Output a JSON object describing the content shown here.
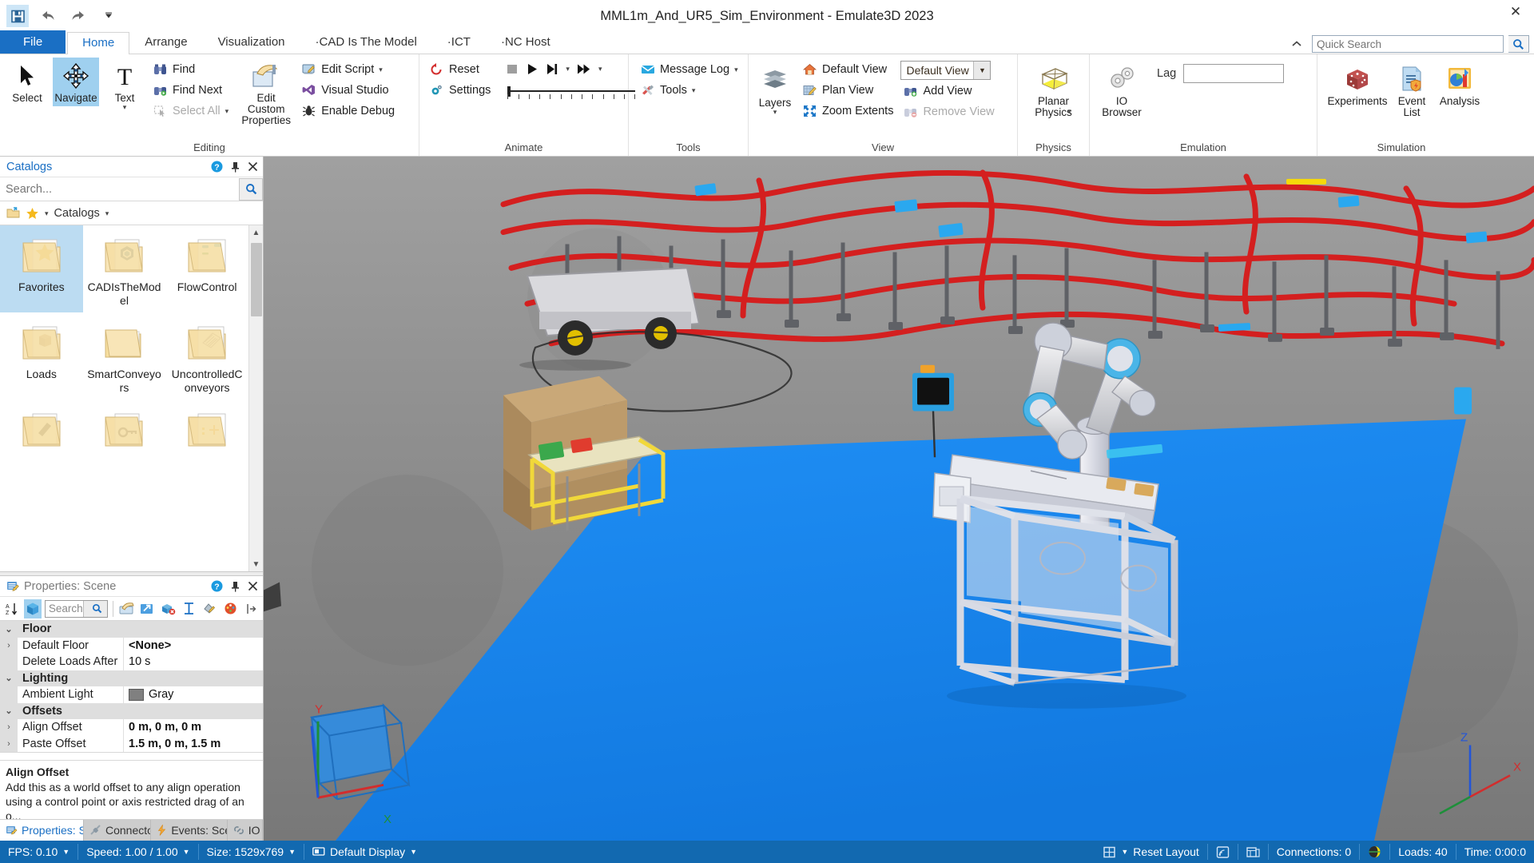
{
  "window": {
    "title": "MML1m_And_UR5_Sim_Environment - Emulate3D 2023",
    "close_label": "✕"
  },
  "quick_access": {
    "save_icon": "save-icon",
    "undo_icon": "undo-icon",
    "redo_icon": "redo-icon",
    "more_icon": "chevron-down-icon"
  },
  "tabs": [
    {
      "label": "File",
      "type": "file"
    },
    {
      "label": "Home",
      "type": "active"
    },
    {
      "label": "Arrange",
      "type": "normal"
    },
    {
      "label": "Visualization",
      "type": "normal"
    },
    {
      "label": "·CAD Is The Model",
      "type": "normal"
    },
    {
      "label": "·ICT",
      "type": "normal"
    },
    {
      "label": "·NC Host",
      "type": "normal"
    }
  ],
  "collapse_ribbon_icon": "chevron-up-icon",
  "search": {
    "placeholder": "Quick Search",
    "value": "",
    "icon": "search-icon"
  },
  "ribbon": {
    "groups": [
      {
        "label": "Editing",
        "big_buttons": [
          {
            "label": "Select",
            "icon": "cursor-arrow-icon",
            "selected": false
          },
          {
            "label": "Navigate",
            "icon": "move-cross-icon",
            "selected": true
          },
          {
            "label": "Text",
            "icon": "text-t-icon",
            "selected": false,
            "dropdown": true
          },
          {
            "label": "Edit Custom\nProperties",
            "icon": "edit-custom-properties-icon",
            "selected": false
          }
        ],
        "small_buttons_1": [
          {
            "label": "Find",
            "icon": "binoculars-icon",
            "disabled": false
          },
          {
            "label": "Find Next",
            "icon": "binoculars-next-icon",
            "disabled": false
          },
          {
            "label": "Select All",
            "icon": "select-all-icon",
            "disabled": true,
            "dropdown": true
          }
        ],
        "small_buttons_2": [
          {
            "label": "Edit Script",
            "icon": "edit-script-icon",
            "dropdown": true
          },
          {
            "label": "Visual Studio",
            "icon": "visual-studio-icon"
          },
          {
            "label": "Enable Debug",
            "icon": "bug-icon"
          }
        ]
      },
      {
        "label": "Animate",
        "small_buttons_1": [
          {
            "label": "Reset",
            "icon": "reset-circular-arrow-icon"
          },
          {
            "label": "Settings",
            "icon": "settings-gear-icon"
          }
        ],
        "transport": [
          {
            "name": "stop-button",
            "icon": "stop-square-icon"
          },
          {
            "name": "play-button",
            "icon": "play-triangle-icon"
          },
          {
            "name": "step-button",
            "icon": "step-forward-icon"
          },
          {
            "name": "step-dropdown",
            "icon": "chevron-down-icon"
          },
          {
            "name": "fast-forward-button",
            "icon": "fast-forward-icon"
          },
          {
            "name": "fast-forward-dropdown",
            "icon": "chevron-down-icon"
          }
        ],
        "speed_slider": {
          "name": "speed-slider",
          "value": 0,
          "ticks": 13
        }
      },
      {
        "label": "Tools",
        "small_buttons_1": [
          {
            "label": "Message Log",
            "icon": "envelope-icon",
            "dropdown": true
          },
          {
            "label": "Tools",
            "icon": "tools-wrench-icon",
            "dropdown": true
          }
        ]
      },
      {
        "label": "View",
        "big_buttons": [
          {
            "label": "Layers",
            "icon": "layers-stack-icon",
            "dropdown": true
          }
        ],
        "small_buttons_1": [
          {
            "label": "Default View",
            "icon": "home-view-icon"
          },
          {
            "label": "Plan View",
            "icon": "plan-view-icon"
          },
          {
            "label": "Zoom Extents",
            "icon": "zoom-extents-icon"
          }
        ],
        "view_select": {
          "value": "Default View",
          "name": "view-selector"
        },
        "small_buttons_2": [
          {
            "label": "Add View",
            "icon": "add-view-binoculars-icon",
            "disabled": false
          },
          {
            "label": "Remove View",
            "icon": "remove-view-binoculars-icon",
            "disabled": true
          }
        ]
      },
      {
        "label": "Physics",
        "big_buttons": [
          {
            "label": "Planar\nPhysics",
            "icon": "planar-physics-cube-icon",
            "dropdown": true
          }
        ]
      },
      {
        "label": "Emulation",
        "big_buttons": [
          {
            "label": "IO\nBrowser",
            "icon": "io-browser-gears-icon"
          }
        ],
        "lag": {
          "label": "Lag",
          "value": "",
          "name": "lag-input"
        }
      },
      {
        "label": "Simulation",
        "big_buttons": [
          {
            "label": "Experiments",
            "icon": "dice-icon"
          },
          {
            "label": "Event\nList",
            "icon": "event-list-icon"
          },
          {
            "label": "Analysis",
            "icon": "analysis-chart-icon"
          }
        ]
      }
    ]
  },
  "catalogs_panel": {
    "title": "Catalogs",
    "help_icon": "help-circle-icon",
    "pin_icon": "pin-icon",
    "close_icon": "close-icon",
    "search_placeholder": "Search...",
    "search_value": "",
    "search_icon": "search-icon",
    "breadcrumb": {
      "open_folder_icon": "open-folder-icon",
      "favorites_icon": "star-icon",
      "favorites_caret": "chevron-down-icon",
      "label": "Catalogs",
      "label_caret": "chevron-down-icon"
    },
    "items": [
      {
        "label": "Favorites",
        "icon": "folder-star-icon",
        "selected": true
      },
      {
        "label": "CADIsTheModel",
        "icon": "folder-cad-icon",
        "selected": false
      },
      {
        "label": "FlowControl",
        "icon": "folder-flowcontrol-icon",
        "selected": false
      },
      {
        "label": "Loads",
        "icon": "folder-box-icon",
        "selected": false
      },
      {
        "label": "SmartConveyors",
        "icon": "folder-plain-icon",
        "selected": false
      },
      {
        "label": "UncontrolledConveyors",
        "icon": "folder-conveyor-icon",
        "selected": false
      },
      {
        "label": "",
        "icon": "folder-marker-icon",
        "selected": false
      },
      {
        "label": "",
        "icon": "folder-key-icon",
        "selected": false
      },
      {
        "label": "",
        "icon": "folder-misc-icon",
        "selected": false
      }
    ],
    "scroll_up_icon": "chevron-up-icon",
    "scroll_down_icon": "chevron-down-icon"
  },
  "properties_panel": {
    "title": "Properties: Scene",
    "title_icon": "properties-icon",
    "help_icon": "help-circle-icon",
    "pin_icon": "pin-icon",
    "close_icon": "close-icon",
    "toolbar": {
      "sort_icon": "sort-az-icon",
      "cube_icon": "cube-icon",
      "search_placeholder": "Search",
      "search_value": "",
      "search_icon": "search-icon",
      "icons": [
        "handshake-icon",
        "move-arrow-icon",
        "delete-object-icon",
        "dimension-icon",
        "paint-bucket-icon",
        "color-palette-icon",
        "expand-icon"
      ]
    },
    "rows": [
      {
        "kind": "category",
        "name": "Floor",
        "expander": "ⱟ"
      },
      {
        "kind": "prop",
        "name": "Default Floor",
        "value": "<None>",
        "expander": "›",
        "bold": true
      },
      {
        "kind": "prop",
        "name": "Delete Loads After",
        "value": "10 s",
        "expander": "",
        "bold": false
      },
      {
        "kind": "category",
        "name": "Lighting",
        "expander": "ⱟ"
      },
      {
        "kind": "prop",
        "name": "Ambient Light",
        "value": "Gray",
        "expander": "",
        "swatch": "#808080",
        "bold": false
      },
      {
        "kind": "category",
        "name": "Offsets",
        "expander": "ⱟ"
      },
      {
        "kind": "prop",
        "name": "Align Offset",
        "value": "0 m, 0 m, 0 m",
        "expander": "›",
        "bold": true
      },
      {
        "kind": "prop",
        "name": "Paste Offset",
        "value": "1.5 m, 0 m, 1.5 m",
        "expander": "›",
        "bold": true
      }
    ],
    "help": {
      "title": "Align Offset",
      "text": "Add this as a world offset to any align operation using a control point or axis restricted drag of an o..."
    }
  },
  "dock_tabs": [
    {
      "label": "Properties: Sc",
      "icon": "properties-icon",
      "active": true
    },
    {
      "label": "Connecto",
      "icon": "connector-icon",
      "active": false
    },
    {
      "label": "Events: Sce",
      "icon": "events-lightning-icon",
      "active": false
    },
    {
      "label": "IO",
      "icon": "io-link-icon",
      "active": false
    }
  ],
  "viewport": {
    "axis_gizmo": {
      "x_label": "X",
      "y_label": "Y",
      "z_label": "Z"
    },
    "nav_cube": {
      "z_label": "Z",
      "x_label": "X",
      "y_label": "Y"
    },
    "scene_description": "3D simulation scene with UR5 robot arm, conveyor network and blue floor plane"
  },
  "status_bar": {
    "left": [
      {
        "label": "FPS: 0.10",
        "caret": true,
        "name": "fps-status"
      },
      {
        "label": "Speed: 1.00 / 1.00",
        "caret": true,
        "name": "speed-status"
      },
      {
        "label": "Size: 1529x769",
        "caret": true,
        "name": "size-status"
      },
      {
        "label": "Default Display",
        "caret": true,
        "icon": "display-icon",
        "name": "display-status"
      }
    ],
    "right": [
      {
        "label": "Reset Layout",
        "caret": true,
        "icon": "layout-grid-icon",
        "name": "reset-layout-status"
      },
      {
        "label": "",
        "icon": "broadcast-icon",
        "name": "broadcast-status"
      },
      {
        "label": "",
        "icon": "panels-icon",
        "name": "panels-status"
      },
      {
        "label": "Connections: 0",
        "name": "connections-status"
      },
      {
        "label": "",
        "icon": "globe-icon",
        "name": "globe-status"
      },
      {
        "label": "Loads: 40",
        "name": "loads-status"
      },
      {
        "label": "Time: 0:00:0",
        "name": "time-status"
      }
    ]
  }
}
